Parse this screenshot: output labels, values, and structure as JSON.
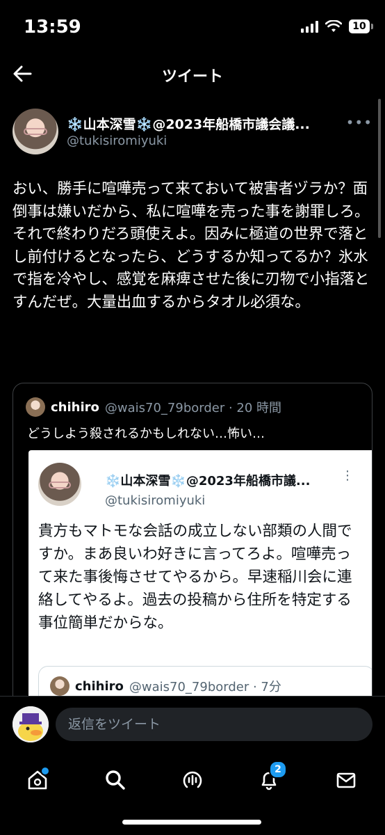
{
  "status_bar": {
    "time": "13:59",
    "battery": "10"
  },
  "header": {
    "title": "ツイート"
  },
  "tweet": {
    "author": "❄️山本深雪❄️@2023年船橋市議会議...",
    "handle": "@tukisiromiyuki",
    "more": "•••",
    "body": "おい、勝手に喧嘩売って来ておいて被害者ヅラか？面倒事は嫌いだから、私に喧嘩を売った事を謝罪しろ。それで終わりだろ頭使えよ。因みに極道の世界で落とし前付けるとなったら、どうするか知ってるか？氷水で指を冷やし、感覚を麻痺させた後に刃物で小指落とすんだぜ。大量出血するからタオル必須な。"
  },
  "quote": {
    "name": "chihiro",
    "meta": "@wais70_79border · 20 時間",
    "text": "どうしよう殺されるかもしれない…怖い…",
    "embedded": {
      "author": "❄️山本深雪❄️@2023年船橋市議...",
      "handle": "@tukisiromiyuki",
      "more": "⋮",
      "body": "貴方もマトモな会話の成立しない部類の人間ですか。まあ良いわ好きに言ってろよ。喧嘩売って来た事後悔させてやるから。早速稲川会に連絡してやるよ。過去の投稿から住所を特定する事位簡単だからな。",
      "quoted": {
        "name": "chihiro",
        "meta": "@wais70_79border · 7分"
      }
    }
  },
  "reply": {
    "placeholder": "返信をツイート"
  },
  "tabs": {
    "notifications_count": "2"
  },
  "colors": {
    "background": "#000000",
    "accent": "#1d9bf0",
    "muted": "#8b98a5",
    "card": "#ffffff"
  }
}
